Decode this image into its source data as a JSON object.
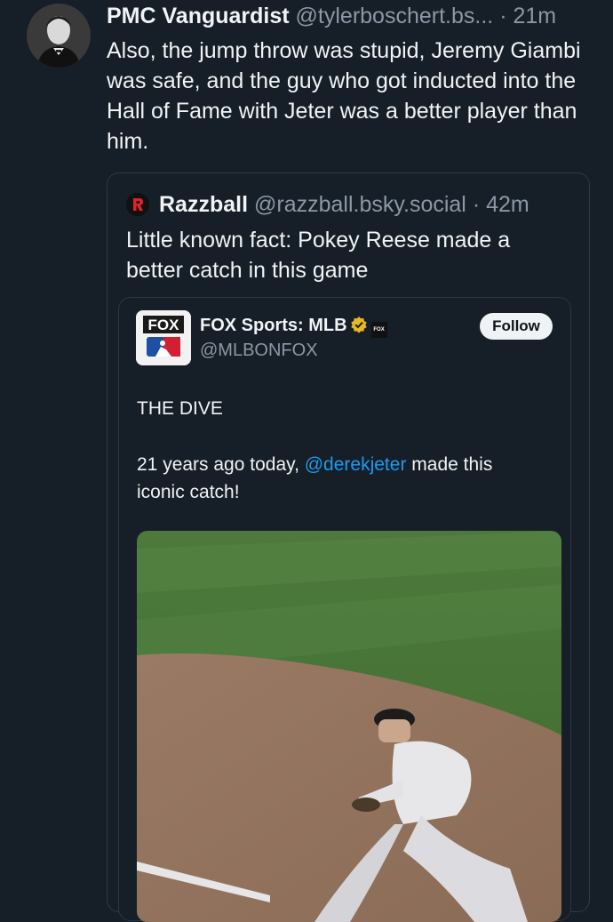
{
  "post": {
    "display_name": "PMC Vanguardist",
    "handle": "@tylerboschert.bs...",
    "separator": "·",
    "time": "21m",
    "text": "Also, the jump throw was stupid, Jeremy Giambi was safe, and the guy who got inducted into the Hall of Fame with Jeter was a better player than him."
  },
  "quote": {
    "display_name": "Razzball",
    "handle": "@razzball.bsky.social",
    "separator": "·",
    "time": "42m",
    "text": "Little known fact: Pokey Reese made a better catch in this game"
  },
  "embed": {
    "account_name": "FOX Sports: MLB",
    "handle": "@MLBONFOX",
    "follow_label": "Follow",
    "logo_text": "FOX",
    "badge_text": "FOX",
    "title": "THE DIVE",
    "body_before": "21 years ago today, ",
    "mention": "@derekjeter",
    "body_after": " made this iconic catch!"
  },
  "colors": {
    "background": "#161e27",
    "text": "#f1f3f5",
    "muted": "#8b98a5",
    "link": "#1d9bf0",
    "border": "#2e3b4a"
  },
  "icons": {
    "verified": "verified-badge-icon",
    "razzball": "razzball-logo-icon"
  }
}
